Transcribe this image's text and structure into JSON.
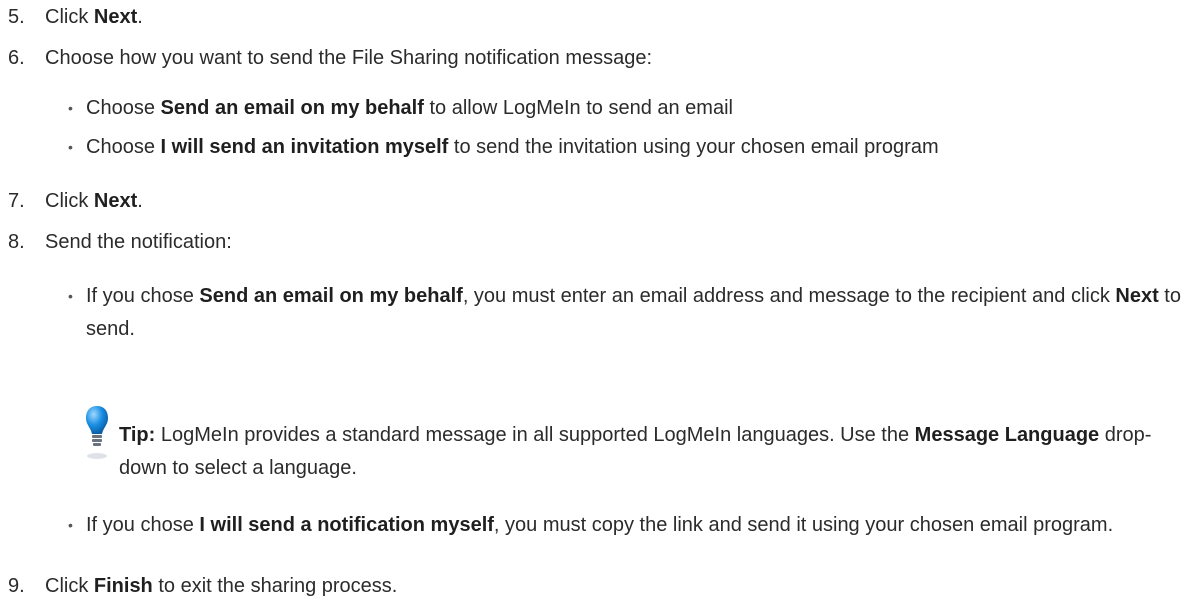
{
  "steps": {
    "s5": {
      "num": "5.",
      "pre": "Click ",
      "bold": "Next",
      "post": "."
    },
    "s6": {
      "num": "6.",
      "text": "Choose how you want to send the File Sharing notification message:"
    },
    "s6b1": {
      "pre": "Choose ",
      "bold": "Send an email on my behalf",
      "post": " to allow LogMeIn to send an email"
    },
    "s6b2": {
      "pre": "Choose ",
      "bold": "I will send an invitation myself",
      "post": " to send the invitation using your chosen email program"
    },
    "s7": {
      "num": "7.",
      "pre": "Click ",
      "bold": "Next",
      "post": "."
    },
    "s8": {
      "num": "8.",
      "text": "Send the notification:"
    },
    "s8b1": {
      "pre": "If you chose ",
      "bold1": "Send an email on my behalf",
      "mid": ", you must enter an email address and message to the recipient and click ",
      "bold2": "Next",
      "post": " to send."
    },
    "tip": {
      "label": "Tip:",
      "text1": " LogMeIn provides a standard message in all supported LogMeIn languages. Use the ",
      "bold": "Message Language",
      "text2": " drop-down to select a language.",
      "icon": "lightbulb-icon",
      "icon_color": "#1a8fe3"
    },
    "s8b2": {
      "pre": "If you chose ",
      "bold": "I will send a notification myself",
      "post": ", you must copy the link and send it using your chosen email program."
    },
    "s9": {
      "num": "9.",
      "pre": "Click ",
      "bold": "Finish",
      "post": " to exit the sharing process."
    }
  },
  "bullet_char": "•"
}
